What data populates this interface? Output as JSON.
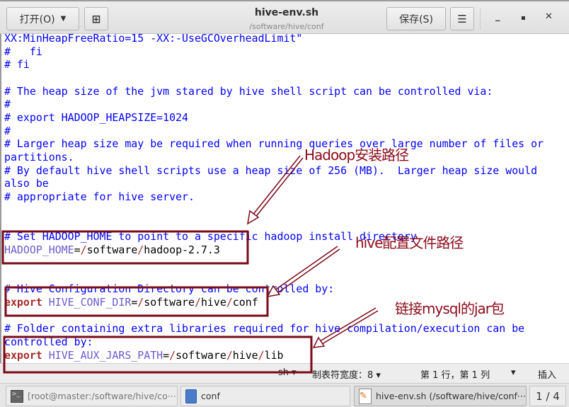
{
  "header": {
    "open_label": "打开(O)",
    "title": "hive-env.sh",
    "subtitle": "/software/hive/conf",
    "save_label": "保存(S)",
    "menu_icon": "hamburger-icon",
    "new_doc_icon": "new-document-icon"
  },
  "code_lines": [
    [
      [
        "cm",
        "XX:MinHeapFreeRatio=15 -XX:-UseGCOverheadLimit\""
      ]
    ],
    [
      [
        "cm",
        "#   fi"
      ]
    ],
    [
      [
        "cm",
        "# fi"
      ]
    ],
    [],
    [
      [
        "cm",
        "# The heap size of the jvm stared by hive shell script can be controlled via:"
      ]
    ],
    [
      [
        "cm",
        "#"
      ]
    ],
    [
      [
        "cm",
        "# export HADOOP_HEAPSIZE=1024"
      ]
    ],
    [
      [
        "cm",
        "#"
      ]
    ],
    [
      [
        "cm",
        "# Larger heap size may be required when running queries over large number of files or"
      ]
    ],
    [
      [
        "cm",
        "partitions."
      ]
    ],
    [
      [
        "cm",
        "# By default hive shell scripts use a heap size of 256 (MB).  Larger heap size would"
      ]
    ],
    [
      [
        "cm",
        "also be"
      ]
    ],
    [
      [
        "cm",
        "# appropriate for hive server."
      ]
    ],
    [],
    [],
    [
      [
        "cm",
        "# Set HADOOP_HOME to point to a specific hadoop install directory"
      ]
    ],
    [
      [
        "var",
        "HADOOP_HOME"
      ],
      [
        "tx",
        "="
      ],
      [
        "sl",
        "/"
      ],
      [
        "tx",
        "software"
      ],
      [
        "sl",
        "/"
      ],
      [
        "tx",
        "hadoop-2.7.3"
      ]
    ],
    [],
    [],
    [
      [
        "cm",
        "# Hive Configuration Directory can be controlled by:"
      ]
    ],
    [
      [
        "kw",
        "export"
      ],
      [
        "tx",
        " "
      ],
      [
        "var",
        "HIVE_CONF_DIR"
      ],
      [
        "tx",
        "="
      ],
      [
        "sl",
        "/"
      ],
      [
        "tx",
        "software"
      ],
      [
        "sl",
        "/"
      ],
      [
        "tx",
        "hive"
      ],
      [
        "sl",
        "/"
      ],
      [
        "tx",
        "conf"
      ]
    ],
    [],
    [
      [
        "cm",
        "# Folder containing extra libraries required for hive compilation/execution can be"
      ]
    ],
    [
      [
        "cm",
        "controlled by:"
      ]
    ],
    [
      [
        "kw",
        "export"
      ],
      [
        "tx",
        " "
      ],
      [
        "var",
        "HIVE_AUX_JARS_PATH"
      ],
      [
        "tx",
        "="
      ],
      [
        "sl",
        "/"
      ],
      [
        "tx",
        "software"
      ],
      [
        "sl",
        "/"
      ],
      [
        "tx",
        "hive"
      ],
      [
        "sl",
        "/"
      ],
      [
        "tx",
        "lib"
      ]
    ]
  ],
  "status": {
    "language": "sh ▾",
    "tab_width": "制表符宽度：8 ▾",
    "position": "第 1 行，第 1 列",
    "position_arrow": "▾",
    "mode": "插入"
  },
  "taskbar": {
    "items": [
      {
        "label": "[root@master:/software/hive/co···",
        "icon": "terminal-icon"
      },
      {
        "label": "conf",
        "icon": "file-cabinet-icon"
      },
      {
        "label": "hive-env.sh (/software/hive/conf···",
        "icon": "text-editor-icon"
      }
    ],
    "pager": "1 / 4"
  },
  "annotations": {
    "hadoop": "Hadoop安装路径",
    "hive_conf": "hive配置文件路径",
    "mysql_jar": "链接mysql的jar包",
    "color": "#8b0a1a"
  },
  "colors": {
    "comment": "#0000ff",
    "variable": "#6a5acd",
    "slash": "#a52a2a",
    "keyword": "#a52a2a"
  }
}
